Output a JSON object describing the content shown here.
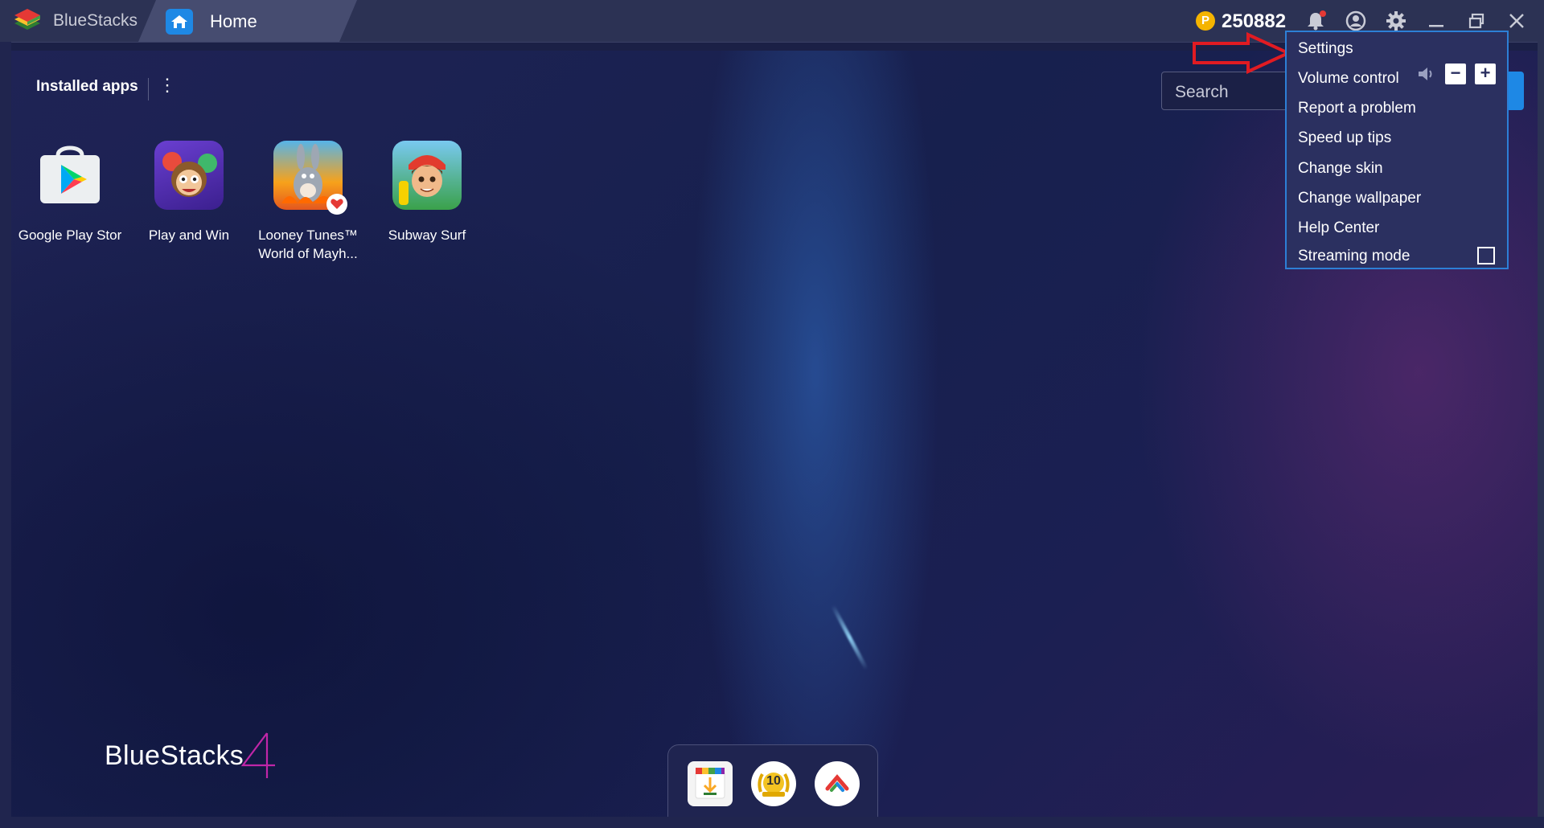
{
  "window": {
    "app_name": "BlueStacks",
    "tab_label": "Home",
    "coin_symbol": "P",
    "coin_count": "250882"
  },
  "icons": {
    "logo": "bluestacks-logo-icon",
    "home": "home-icon",
    "coin": "coin-icon",
    "bell": "bell-icon",
    "account": "account-icon",
    "settings": "gear-icon",
    "minimize": "minimize-icon",
    "restore": "restore-icon",
    "close": "close-icon"
  },
  "installed": {
    "title": "Installed apps",
    "more_glyph": "⋮",
    "apps": [
      {
        "label": "Google Play Stor",
        "icon": "google-play-store-icon"
      },
      {
        "label": "Play and Win",
        "icon": "play-and-win-icon"
      },
      {
        "label": "Looney Tunes™ World of Mayh...",
        "icon": "looney-tunes-icon"
      },
      {
        "label": "Subway Surf",
        "icon": "subway-surf-icon"
      }
    ]
  },
  "search": {
    "placeholder": "Search"
  },
  "menu": {
    "items": [
      "Settings",
      "Volume control",
      "Report a problem",
      "Speed up tips",
      "Change skin",
      "Change wallpaper",
      "Help Center",
      "Streaming mode"
    ],
    "volume_minus": "−",
    "volume_plus": "+",
    "streaming_checked": false
  },
  "footer": {
    "wordmark": "BlueStacks",
    "version_glyph": "4",
    "dock_level": "10"
  },
  "colors": {
    "accent": "#1e88e5",
    "menu_bg": "#2b3060",
    "menu_border": "#2d7fd6",
    "arrow": "#e11b22",
    "coin": "#f5b400"
  }
}
